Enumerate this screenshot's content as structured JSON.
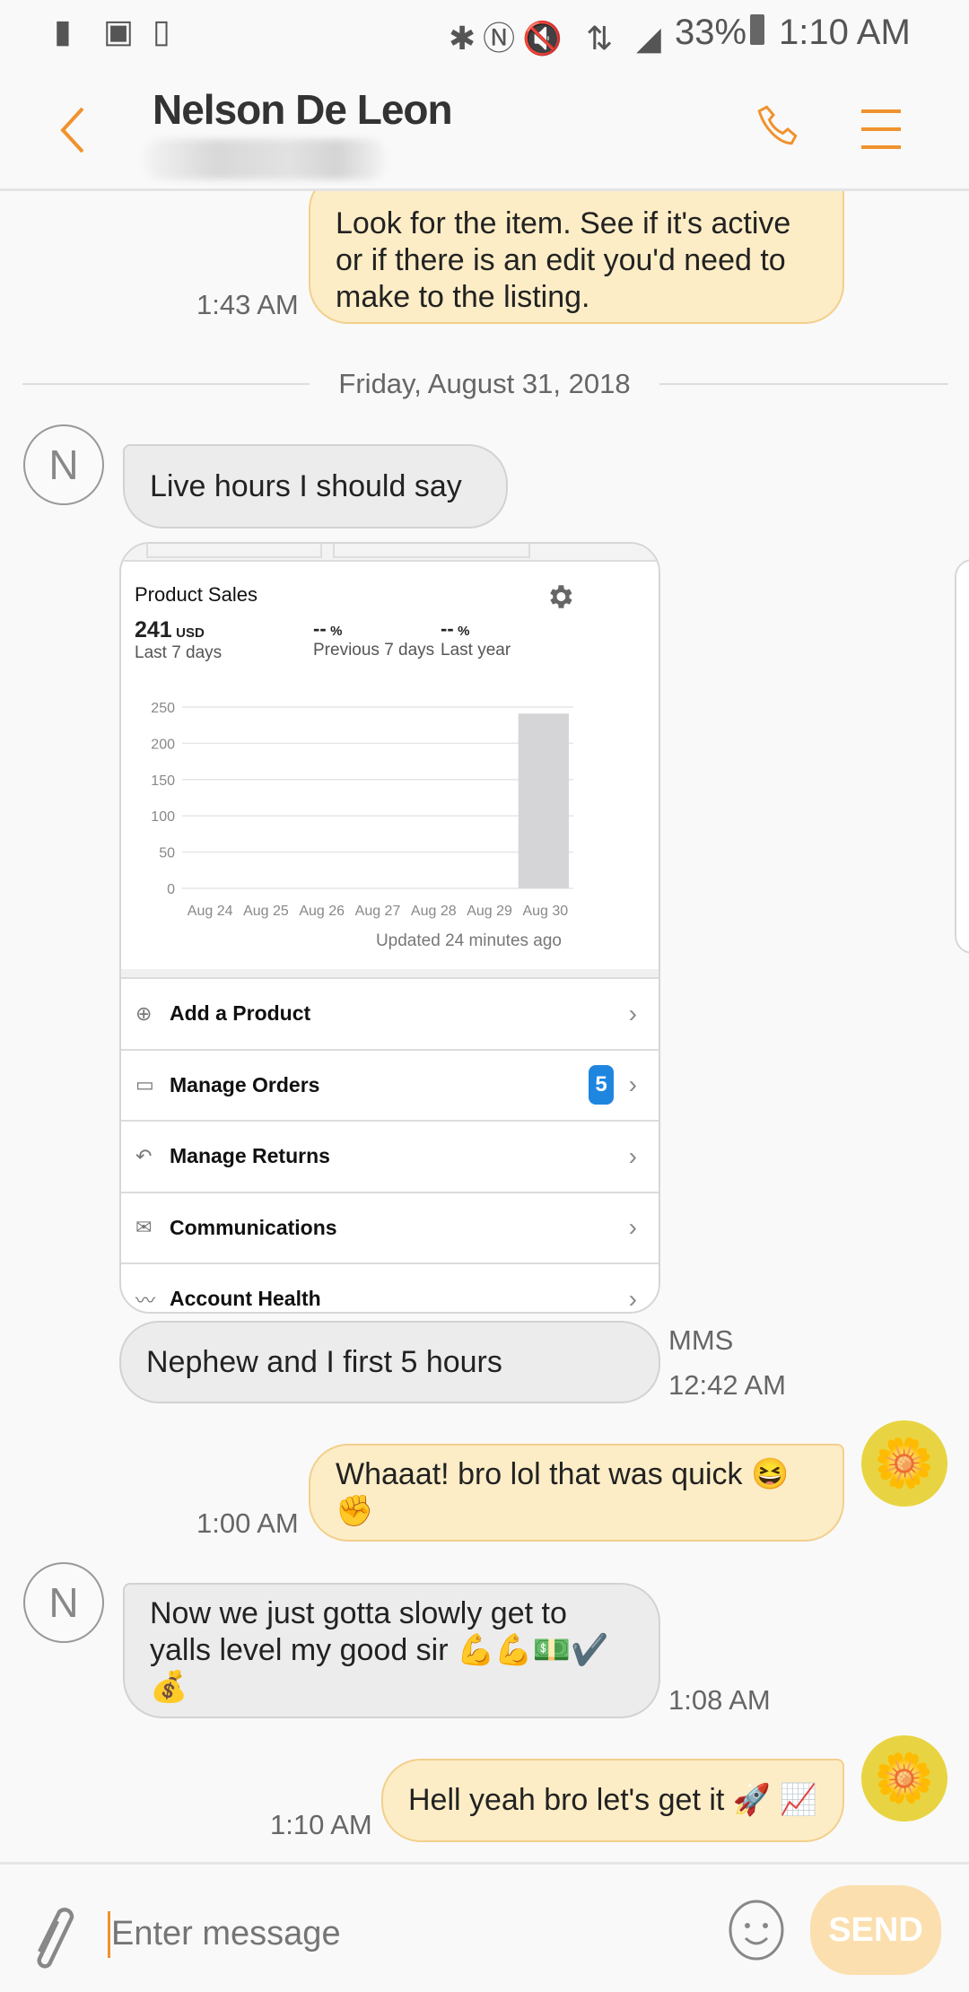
{
  "status_bar": {
    "time": "1:10 AM",
    "battery": "33%",
    "left_icons": [
      "message-icon",
      "image-icon",
      "device-clock-icon"
    ],
    "right_icons": [
      "bluetooth-icon",
      "nfc-icon",
      "mute-icon",
      "4g-lte-icon",
      "signal-icon",
      "battery-icon"
    ]
  },
  "header": {
    "contact_name": "Nelson De Leon",
    "back_icon": "chevron-left-icon",
    "call_icon": "phone-icon",
    "menu_icon": "menu-icon",
    "accent": "#f0922e"
  },
  "messages": [
    {
      "type": "out",
      "lines": [
        "Look for the item. See if it's active",
        "or if there is an edit you'd need to",
        "make to the listing."
      ],
      "time": "1:43 AM"
    },
    {
      "type": "date",
      "text": "Friday, August 31, 2018"
    },
    {
      "type": "in",
      "avatar": "N",
      "lines": [
        "Live hours I should say"
      ]
    },
    {
      "type": "in",
      "lines": [
        "Nephew and I first 5 hours"
      ],
      "meta": "MMS",
      "time": "12:42 AM"
    },
    {
      "type": "out",
      "lines": [
        "Whaaat! bro lol that was quick 😆",
        "✊"
      ],
      "time": "1:00 AM"
    },
    {
      "type": "in",
      "avatar": "N",
      "lines": [
        "Now we just gotta slowly get to",
        "yalls level my good sir 💪💪💵✔️",
        "💰"
      ],
      "time": "1:08 AM"
    },
    {
      "type": "out",
      "lines": [
        "Hell yeah bro let's get it 🚀 📈"
      ],
      "time": "1:10 AM"
    }
  ],
  "image_card": {
    "title": "Product Sales",
    "stats": [
      {
        "value": "241",
        "unit": "USD",
        "label": "Last 7 days"
      },
      {
        "value": "--",
        "unit": "%",
        "label": "Previous 7 days"
      },
      {
        "value": "--",
        "unit": "%",
        "label": "Last year"
      }
    ],
    "updated": "Updated 24 minutes ago",
    "menu": [
      {
        "label": "Add a Product",
        "icon": "tag-add-icon"
      },
      {
        "label": "Manage Orders",
        "icon": "box-icon",
        "badge": "5"
      },
      {
        "label": "Manage Returns",
        "icon": "return-icon"
      },
      {
        "label": "Communications",
        "icon": "mail-icon"
      },
      {
        "label": "Account Health",
        "icon": "trend-icon"
      }
    ]
  },
  "chart_data": {
    "type": "bar",
    "categories": [
      "Aug 24",
      "Aug 25",
      "Aug 26",
      "Aug 27",
      "Aug 28",
      "Aug 29",
      "Aug 30"
    ],
    "values": [
      0,
      0,
      0,
      0,
      0,
      0,
      241
    ],
    "ylim": [
      0,
      250
    ],
    "yticks": [
      0,
      50,
      100,
      150,
      200,
      250
    ],
    "grid": true,
    "bar_color": "#d5d5d7"
  },
  "composer": {
    "placeholder": "Enter message",
    "send_label": "SEND",
    "send_color": "#fbdfae"
  }
}
